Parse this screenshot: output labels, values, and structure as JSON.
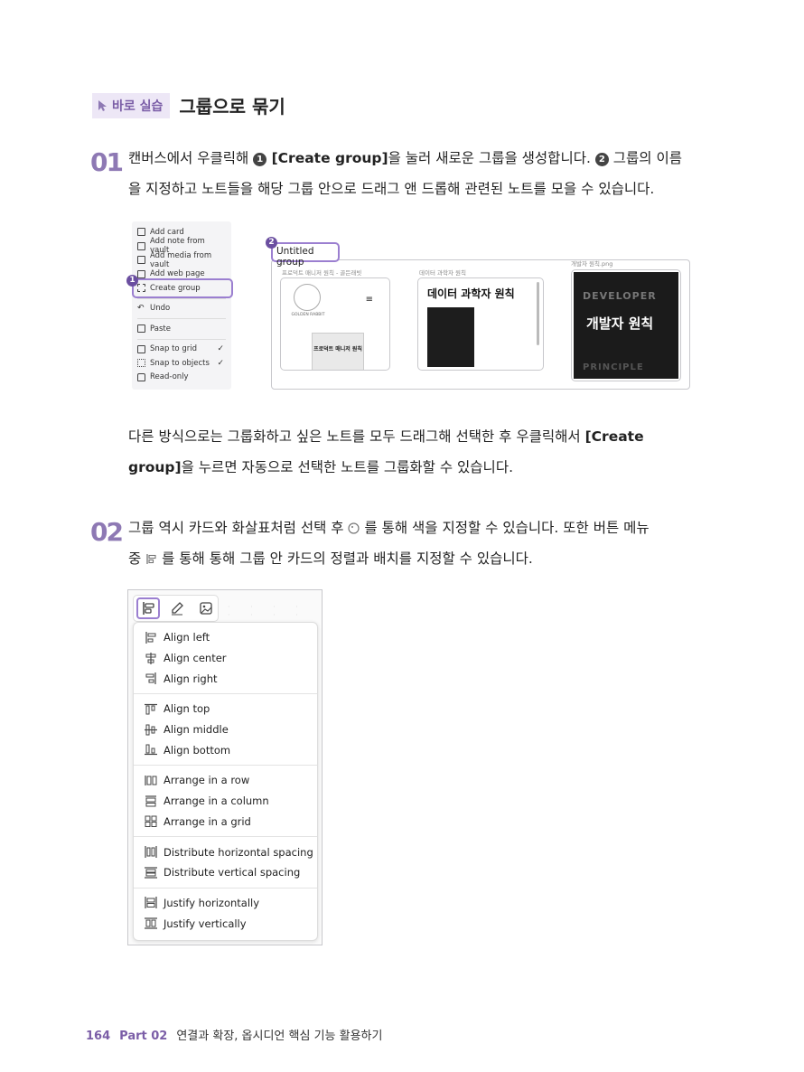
{
  "heading": {
    "badge": "바로 실습",
    "title": "그룹으로 묶기"
  },
  "step1": {
    "number": "01",
    "line1_a": "캔버스에서 우클릭해 ",
    "callout1": "1",
    "line1_b": " [Create group]",
    "line1_c": "을 눌러 새로운 그룹을 생성합니다. ",
    "callout2": "2",
    "line1_d": " 그룹의 이름",
    "line2": "을 지정하고 노트들을 해당 그룹 안으로 드래그 앤 드롭해 관련된 노트를 모을 수 있습니다."
  },
  "context_menu": {
    "items": [
      {
        "label": "Add card"
      },
      {
        "label": "Add note from vault"
      },
      {
        "label": "Add media from vault"
      },
      {
        "label": "Add web page"
      },
      {
        "label": "Create group"
      },
      {
        "label": "Undo"
      },
      {
        "label": "Paste"
      },
      {
        "label": "Snap to grid",
        "check": "✓"
      },
      {
        "label": "Snap to objects",
        "check": "✓"
      },
      {
        "label": "Read-only"
      }
    ],
    "callout": "1"
  },
  "canvas_group": {
    "label": "Untitled group",
    "callout": "2",
    "card1_caption": "프로덕트 매니저 원칙 - 골든래빗",
    "card1_logo": "GOLDEN RABBIT",
    "card1_book": "프로덕트 매니저 원칙",
    "card2_caption": "데이터 과학자 원칙",
    "card2_title": "데이터 과학자 원칙",
    "card3_caption": "개발자 원칙.png",
    "card3_top": "DEVELOPER",
    "card3_title": "개발자 원칙",
    "card3_bottom": "PRINCIPLE"
  },
  "para_mid": {
    "line1_a": "다른 방식으로는 그룹화하고 싶은 노트를 모두 드래그해 선택한 후 우클릭해서 ",
    "line1_b": "[Create",
    "line2_a": "group]",
    "line2_b": "을 누르면 자동으로 선택한 노트를 그룹화할 수 있습니다."
  },
  "step2": {
    "number": "02",
    "line1_a": "그룹 역시 카드와 화살표처럼 선택 후 ",
    "line1_b": " 를 통해 색을 지정할 수 있습니다. 또한 버튼 메뉴",
    "line2_a": "중 ",
    "line2_b": " 를 통해 통해 그룹 안 카드의 정렬과 배치를 지정할 수 있습니다."
  },
  "align_menu": {
    "groups": [
      [
        "Align left",
        "Align center",
        "Align right"
      ],
      [
        "Align top",
        "Align middle",
        "Align bottom"
      ],
      [
        "Arrange in a row",
        "Arrange in a column",
        "Arrange in a grid"
      ],
      [
        "Distribute horizontal spacing",
        "Distribute vertical spacing"
      ],
      [
        "Justify horizontally",
        "Justify vertically"
      ]
    ]
  },
  "footer": {
    "page": "164",
    "part": "Part 02",
    "chapter": "연결과 확장, 옵시디언 핵심 기능 활용하기"
  },
  "colors": {
    "accent": "#7b5ea7",
    "highlight": "#9b7fd0"
  }
}
